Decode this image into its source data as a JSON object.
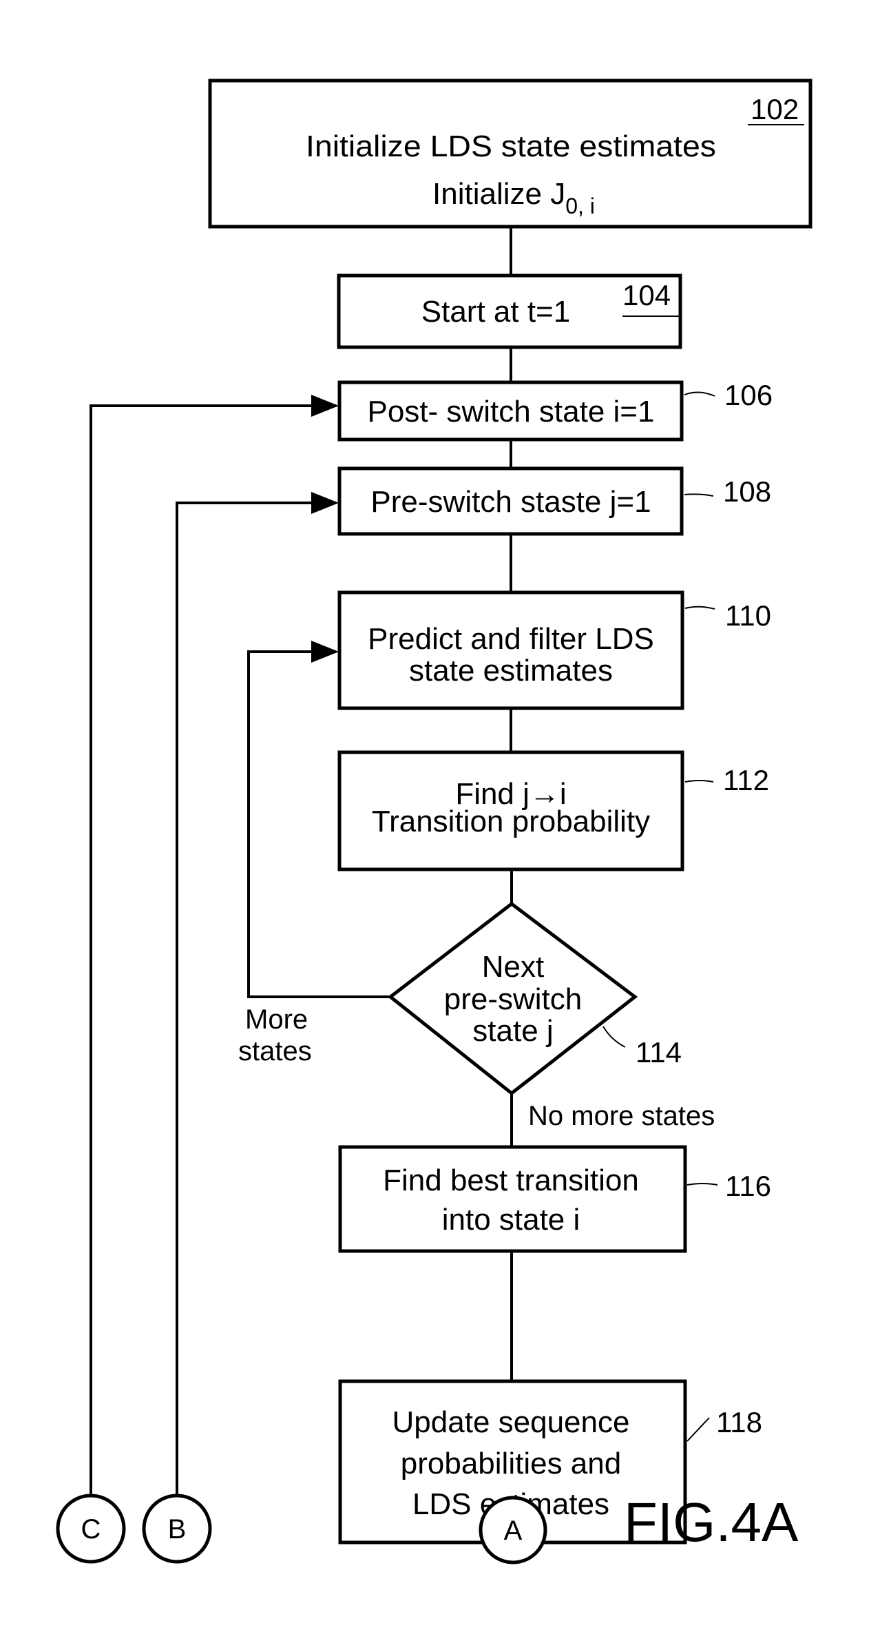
{
  "figure_label": "FIG.4A",
  "colors": {
    "ink": "#000000",
    "paper": "#ffffff"
  },
  "steps": {
    "s102": {
      "ref": "102",
      "line1": "Initialize LDS state estimates",
      "line2_main": "Initialize J",
      "line2_sub": "0, i"
    },
    "s104": {
      "ref": "104",
      "text": "Start at t=1"
    },
    "s106": {
      "ref": "106",
      "text": "Post- switch state i=1"
    },
    "s108": {
      "ref": "108",
      "text": "Pre-switch staste j=1"
    },
    "s110": {
      "ref": "110",
      "line1": "Predict and filter LDS",
      "line2": "state estimates"
    },
    "s112": {
      "ref": "112",
      "line1": "Find j→i",
      "line2": "Transition probability"
    },
    "s114": {
      "ref": "114",
      "line1": "Next",
      "line2": "pre-switch",
      "line3": "state j"
    },
    "s116": {
      "ref": "116",
      "line1": "Find best transition",
      "line2": "into state i"
    },
    "s118": {
      "ref": "118",
      "line1": "Update sequence",
      "line2": "probabilities and",
      "line3": "LDS estimates"
    }
  },
  "branches": {
    "more_line1": "More",
    "more_line2": "states",
    "no_more": "No more states"
  },
  "connectors": {
    "c": "C",
    "b": "B",
    "a": "A"
  }
}
